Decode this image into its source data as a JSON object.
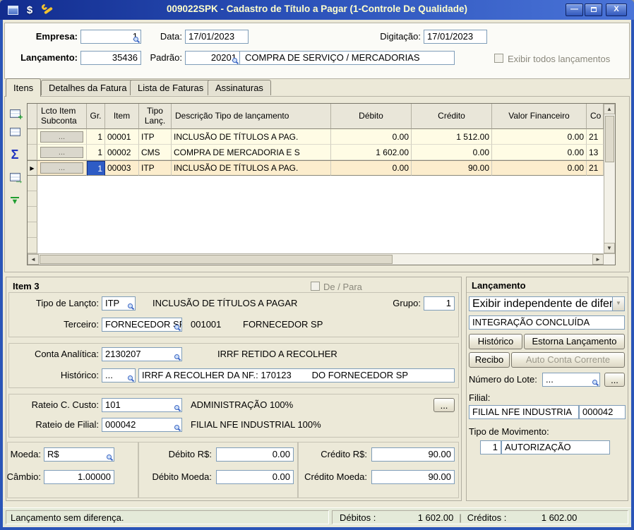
{
  "window": {
    "title": "009022SPK - Cadastro de Título a Pagar (1-Controle De Qualidade)",
    "minimize_glyph": "—",
    "close_glyph": "X"
  },
  "icons": {
    "sigma": "Σ",
    "transfer_arrow": "→",
    "confirm_arrow": "▼",
    "add_plus": "+",
    "row_pointer": "▶",
    "combo_arrow": "▼",
    "scroll_up": "▲",
    "scroll_down": "▼",
    "scroll_left": "◄",
    "scroll_right": "►",
    "dollar": "$"
  },
  "header": {
    "empresa_label": "Empresa:",
    "empresa_value": "1",
    "data_label": "Data:",
    "data_value": "17/01/2023",
    "digitacao_label": "Digitação:",
    "digitacao_value": "17/01/2023",
    "lancamento_label": "Lançamento:",
    "lancamento_value": "35436",
    "padrao_label": "Padrão:",
    "padrao_code": "20201",
    "padrao_desc": "COMPRA DE SERVIÇO / MERCADORIAS",
    "exibir_todos_label": "Exibir todos lançamentos"
  },
  "tabs": {
    "itens": "Itens",
    "detalhes": "Detalhes da Fatura",
    "lista": "Lista de Faturas",
    "assinaturas": "Assinaturas"
  },
  "grid": {
    "columns": [
      "Lcto Item Subconta",
      "Gr.",
      "Item",
      "Tipo Lanç.",
      "Descrição Tipo de lançamento",
      "Débito",
      "Crédito",
      "Valor Financeiro",
      "Co"
    ],
    "rows": [
      {
        "subconta": "...",
        "gr": "1",
        "item": "00001",
        "tipo": "ITP",
        "descricao": "INCLUSÃO DE TÍTULOS A PAG.",
        "debito": "0.00",
        "credito": "1 512.00",
        "valor_financeiro": "0.00",
        "co": "21"
      },
      {
        "subconta": "...",
        "gr": "1",
        "item": "00002",
        "tipo": "CMS",
        "descricao": "COMPRA DE MERCADORIA E S",
        "debito": "1 602.00",
        "credito": "0.00",
        "valor_financeiro": "0.00",
        "co": "13"
      },
      {
        "subconta": "...",
        "gr": "1",
        "item": "00003",
        "tipo": "ITP",
        "descricao": "INCLUSÃO DE TÍTULOS A PAG.",
        "debito": "0.00",
        "credito": "90.00",
        "valor_financeiro": "0.00",
        "co": "21"
      }
    ]
  },
  "item_panel": {
    "title": "Item 3",
    "de_para_label": "De / Para",
    "tipo_lancto_label": "Tipo de Lançto:",
    "tipo_lancto_value": "ITP",
    "tipo_lancto_desc": "INCLUSÃO DE TÍTULOS A PAGAR",
    "grupo_label": "Grupo:",
    "grupo_value": "1",
    "terceiro_label": "Terceiro:",
    "terceiro_value": "FORNECEDOR SP",
    "terceiro_code": "001001",
    "terceiro_desc": "FORNECEDOR SP",
    "conta_label": "Conta Analítica:",
    "conta_value": "2130207",
    "conta_desc": "IRRF RETIDO A RECOLHER",
    "historico_label": "Histórico:",
    "historico_value": "...",
    "historico_text": "IRRF A RECOLHER DA NF.: 170123        DO FORNECEDOR SP",
    "rateio_cc_label": "Rateio C. Custo:",
    "rateio_cc_value": "101",
    "rateio_cc_desc": "ADMINISTRAÇÃO 100%",
    "rateio_cc_more": "...",
    "rateio_filial_label": "Rateio de Filial:",
    "rateio_filial_value": "000042",
    "rateio_filial_desc": "FILIAL NFE INDUSTRIAL 100%",
    "moeda_label": "Moeda:",
    "moeda_value": "R$",
    "cambio_label": "Câmbio:",
    "cambio_value": "1.00000",
    "debito_rs_label": "Débito R$:",
    "debito_rs_value": "0.00",
    "debito_moeda_label": "Débito Moeda:",
    "debito_moeda_value": "0.00",
    "credito_rs_label": "Crédito R$:",
    "credito_rs_value": "90.00",
    "credito_moeda_label": "Crédito Moeda:",
    "credito_moeda_value": "90.00"
  },
  "lancamento_panel": {
    "title": "Lançamento",
    "combo_value": "Exibir independente de difere",
    "status_value": "INTEGRAÇÃO CONCLUÍDA",
    "historico_button": "Histórico",
    "estorna_button": "Estorna Lançamento",
    "recibo_button": "Recibo",
    "auto_cc_button": "Auto Conta Corrente",
    "lote_label": "Número do Lote:",
    "lote_value": "...",
    "lote_button": "...",
    "filial_label": "Filial:",
    "filial_value": "FILIAL NFE INDUSTRIA",
    "filial_code": "000042",
    "tipo_mov_label": "Tipo de Movimento:",
    "tipo_mov_value": "1",
    "tipo_mov_desc": "AUTORIZAÇÃO"
  },
  "status_bar": {
    "message": "Lançamento sem diferença.",
    "debitos_label": "Débitos :",
    "debitos_value": "1 602.00",
    "separator": "|",
    "creditos_label": "Créditos :",
    "creditos_value": "1 602.00"
  },
  "colors": {
    "titlebar_start": "#122c8e",
    "titlebar_end": "#4a74d8",
    "title_text": "#ffffcc",
    "field_border": "#7f9db9",
    "row_yellow": "#fffce5",
    "selected_row": "#fcedcd",
    "selected_cell_blue": "#2e5cc5",
    "client_bg": "#ece9d8",
    "status_bg": "#e4ead9"
  }
}
